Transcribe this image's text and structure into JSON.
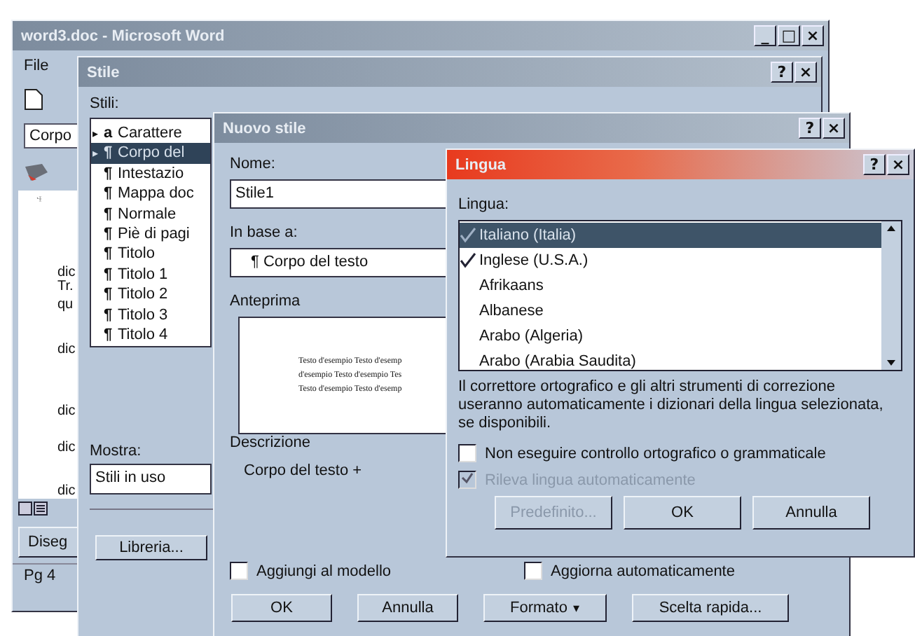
{
  "word_window": {
    "title": "word3.doc - Microsoft Word",
    "window_buttons": [
      "_",
      "□",
      "×"
    ],
    "menu": [
      "File"
    ],
    "style_box": "Corpo",
    "document_lines": [
      "dic",
      "Tr.",
      "qu",
      "dic",
      "dic",
      "dic",
      "dic"
    ],
    "draw_button": "Diseg",
    "status_bar": "Pg 4"
  },
  "stile_dialog": {
    "title": "Stile",
    "window_buttons": [
      "?",
      "×"
    ],
    "styles_label": "Stili:",
    "styles": [
      {
        "marker": "▸",
        "glyph": "a",
        "label": "Carattere",
        "selected": false
      },
      {
        "marker": "▸",
        "glyph": "¶",
        "label": "Corpo del",
        "selected": true
      },
      {
        "glyph": "¶",
        "label": "Intestazio",
        "selected": false
      },
      {
        "glyph": "¶",
        "label": "Mappa doc",
        "selected": false
      },
      {
        "glyph": "¶",
        "label": "Normale",
        "selected": false
      },
      {
        "glyph": "¶",
        "label": "Piè di pagi",
        "selected": false
      },
      {
        "glyph": "¶",
        "label": "Titolo",
        "selected": false
      },
      {
        "glyph": "¶",
        "label": "Titolo 1",
        "selected": false
      },
      {
        "glyph": "¶",
        "label": "Titolo 2",
        "selected": false
      },
      {
        "glyph": "¶",
        "label": "Titolo 3",
        "selected": false
      },
      {
        "glyph": "¶",
        "label": "Titolo 4",
        "selected": false
      }
    ],
    "show_label": "Mostra:",
    "show_value": "Stili in uso",
    "library_button": "Libreria..."
  },
  "nuovo_stile_dialog": {
    "title": "Nuovo stile",
    "window_buttons": [
      "?",
      "×"
    ],
    "name_label": "Nome:",
    "name_value": "Stile1",
    "based_on_label": "In base a:",
    "based_on_value": "¶ Corpo del testo",
    "preview_label": "Anteprima",
    "preview_lines": [
      "Testo d'esempio Testo d'esemp",
      "d'esempio Testo d'esempio Tes",
      "Testo d'esempio Testo d'esemp"
    ],
    "description_label": "Descrizione",
    "description": "Corpo del testo +",
    "checkboxes": [
      {
        "label": "Aggiungi al modello",
        "checked": false
      },
      {
        "label": "Aggiorna automaticamente",
        "checked": false
      }
    ],
    "buttons": [
      "OK",
      "Annulla",
      "Formato",
      "Scelta rapida..."
    ],
    "format_caret": "▾"
  },
  "lingua_dialog": {
    "title": "Lingua",
    "window_buttons": [
      "?",
      "×"
    ],
    "language_label": "Lingua:",
    "languages": [
      {
        "label": "Italiano (Italia)",
        "selected": true,
        "proofing": true
      },
      {
        "label": "Inglese (U.S.A.)",
        "selected": false,
        "proofing": true
      },
      {
        "label": "Afrikaans",
        "selected": false,
        "proofing": false
      },
      {
        "label": "Albanese",
        "selected": false,
        "proofing": false
      },
      {
        "label": "Arabo (Algeria)",
        "selected": false,
        "proofing": false
      },
      {
        "label": "Arabo (Arabia Saudita)",
        "selected": false,
        "proofing": false
      }
    ],
    "note": "Il correttore ortografico e gli altri strumenti di correzione useranno automaticamente i dizionari della lingua selezionata, se disponibili.",
    "checkboxes": [
      {
        "label": "Non eseguire controllo ortografico o grammaticale",
        "checked": false,
        "disabled": false
      },
      {
        "label": "Rileva lingua automaticamente",
        "checked": true,
        "disabled": true
      }
    ],
    "buttons": [
      {
        "label": "Predefinito...",
        "disabled": true
      },
      {
        "label": "OK",
        "disabled": false
      },
      {
        "label": "Annulla",
        "disabled": false
      }
    ]
  }
}
